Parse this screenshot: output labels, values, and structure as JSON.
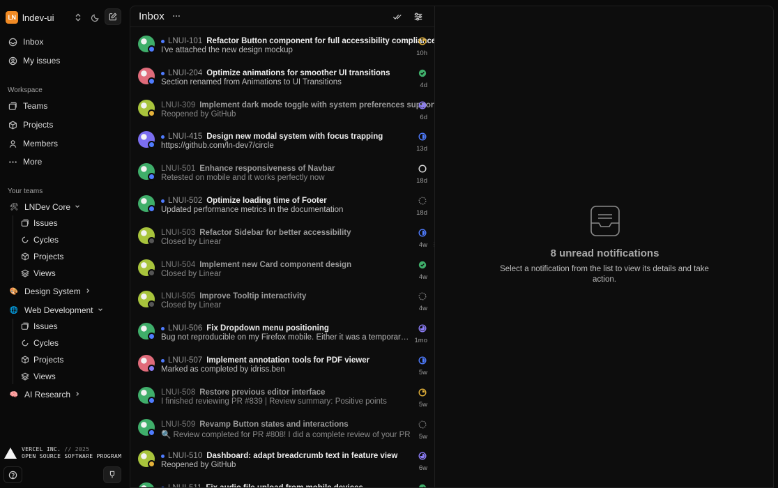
{
  "workspace": {
    "logo": "LN",
    "name": "lndev-ui"
  },
  "nav": {
    "inbox": "Inbox",
    "my_issues": "My issues"
  },
  "workspace_section": {
    "label": "Workspace",
    "items": [
      "Teams",
      "Projects",
      "Members",
      "More"
    ]
  },
  "teams_section": {
    "label": "Your teams",
    "teams": [
      {
        "name": "LNDev Core",
        "icon": "🛠",
        "expanded": true,
        "sub": [
          "Issues",
          "Cycles",
          "Projects",
          "Views"
        ]
      },
      {
        "name": "Design System",
        "icon": "🎨",
        "expanded": false
      },
      {
        "name": "Web Development",
        "icon": "🌐",
        "expanded": true,
        "sub": [
          "Issues",
          "Cycles",
          "Projects",
          "Views"
        ]
      },
      {
        "name": "AI Research",
        "icon": "🧠",
        "expanded": false
      }
    ]
  },
  "footer": {
    "vercel_line1": "VERCEL INC.",
    "vercel_sep": "// 2025",
    "vercel_line2": "OPEN SOURCE SOFTWARE PROGRAM"
  },
  "inbox": {
    "title": "Inbox",
    "notifications": [
      {
        "id": "LNUI-101",
        "title": "Refactor Button component for full accessibility compliance",
        "detail": "I've attached the new design mockup",
        "time": "10h",
        "unread": true,
        "status": "in-progress",
        "status_color": "#e6b33a",
        "avatar": "#3fae6a",
        "badge": "#4f7cff"
      },
      {
        "id": "LNUI-204",
        "title": "Optimize animations for smoother UI transitions",
        "detail": "Section renamed from Animations to UI Transitions",
        "time": "4d",
        "unread": true,
        "status": "done",
        "status_color": "#3fae6a",
        "avatar": "#e06b7a",
        "badge": "#4f7cff"
      },
      {
        "id": "LNUI-309",
        "title": "Implement dark mode toggle with system preferences support",
        "detail": "Reopened by GitHub",
        "time": "6d",
        "unread": false,
        "status": "paused",
        "status_color": "#8b7cf6",
        "avatar": "#a8c43c",
        "badge": "#e6b33a"
      },
      {
        "id": "LNUI-415",
        "title": "Design new modal system with focus trapping",
        "detail": "https://github.com/ln-dev7/circle",
        "time": "13d",
        "unread": true,
        "status": "technical-review",
        "status_color": "#4f7cff",
        "avatar": "#7b6ef0",
        "badge": "#4f7cff"
      },
      {
        "id": "LNUI-501",
        "title": "Enhance responsiveness of Navbar",
        "detail": "Retested on mobile and it works perfectly now",
        "time": "18d",
        "unread": false,
        "status": "todo",
        "status_color": "#d9d9d9",
        "avatar": "#3fae6a",
        "badge": "#4f7cff"
      },
      {
        "id": "LNUI-502",
        "title": "Optimize loading time of Footer",
        "detail": "Updated performance metrics in the documentation",
        "time": "18d",
        "unread": true,
        "status": "backlog",
        "status_color": "#8a8a8a",
        "avatar": "#3fae6a",
        "badge": "#4f7cff"
      },
      {
        "id": "LNUI-503",
        "title": "Refactor Sidebar for better accessibility",
        "detail": "Closed by Linear",
        "time": "4w",
        "unread": false,
        "status": "technical-review",
        "status_color": "#4f7cff",
        "avatar": "#a8c43c",
        "badge": "#555555"
      },
      {
        "id": "LNUI-504",
        "title": "Implement new Card component design",
        "detail": "Closed by Linear",
        "time": "4w",
        "unread": false,
        "status": "done",
        "status_color": "#3fae6a",
        "avatar": "#a8c43c",
        "badge": "#555555"
      },
      {
        "id": "LNUI-505",
        "title": "Improve Tooltip interactivity",
        "detail": "Closed by Linear",
        "time": "4w",
        "unread": false,
        "status": "backlog",
        "status_color": "#8a8a8a",
        "avatar": "#a8c43c",
        "badge": "#555555"
      },
      {
        "id": "LNUI-506",
        "title": "Fix Dropdown menu positioning",
        "detail": "Bug not reproducible on my Firefox mobile. Either it was a temporary issue or",
        "time": "1mo",
        "unread": true,
        "status": "paused",
        "status_color": "#8b7cf6",
        "avatar": "#3fae6a",
        "badge": "#4f7cff"
      },
      {
        "id": "LNUI-507",
        "title": "Implement annotation tools for PDF viewer",
        "detail": "Marked as completed by idriss.ben",
        "time": "5w",
        "unread": true,
        "status": "technical-review",
        "status_color": "#4f7cff",
        "avatar": "#e06b7a",
        "badge": "#8b7cf6"
      },
      {
        "id": "LNUI-508",
        "title": "Restore previous editor interface",
        "detail": "I finished reviewing PR #839 | Review summary: Positive points",
        "time": "5w",
        "unread": false,
        "status": "in-progress",
        "status_color": "#e6b33a",
        "avatar": "#3fae6a",
        "badge": "#4f7cff"
      },
      {
        "id": "LNUI-509",
        "title": "Revamp Button states and interactions",
        "detail": "🔍 Review completed for PR #808! I did a complete review of your PR",
        "time": "5w",
        "unread": false,
        "status": "backlog",
        "status_color": "#8a8a8a",
        "avatar": "#3fae6a",
        "badge": "#4f7cff"
      },
      {
        "id": "LNUI-510",
        "title": "Dashboard: adapt breadcrumb text in feature view",
        "detail": "Reopened by GitHub",
        "time": "6w",
        "unread": true,
        "status": "paused",
        "status_color": "#8b7cf6",
        "avatar": "#a8c43c",
        "badge": "#e6b33a"
      },
      {
        "id": "LNUI-511",
        "title": "Fix audio file upload from mobile devices",
        "detail": "",
        "time": "",
        "unread": true,
        "status": "done",
        "status_color": "#3fae6a",
        "avatar": "#3fae6a",
        "badge": "#4f7cff"
      }
    ]
  },
  "detail": {
    "title": "8 unread notifications",
    "description": "Select a notification from the list to view its details and take action."
  },
  "icons": {
    "compose": "pencil-square-icon",
    "theme": "moon-icon",
    "switch": "chevron-up-down-icon",
    "inbox": "inbox-icon",
    "my_issues": "user-circle-icon",
    "check_all": "check-double-icon",
    "filter": "sliders-icon",
    "empty": "inbox-tray-icon"
  }
}
